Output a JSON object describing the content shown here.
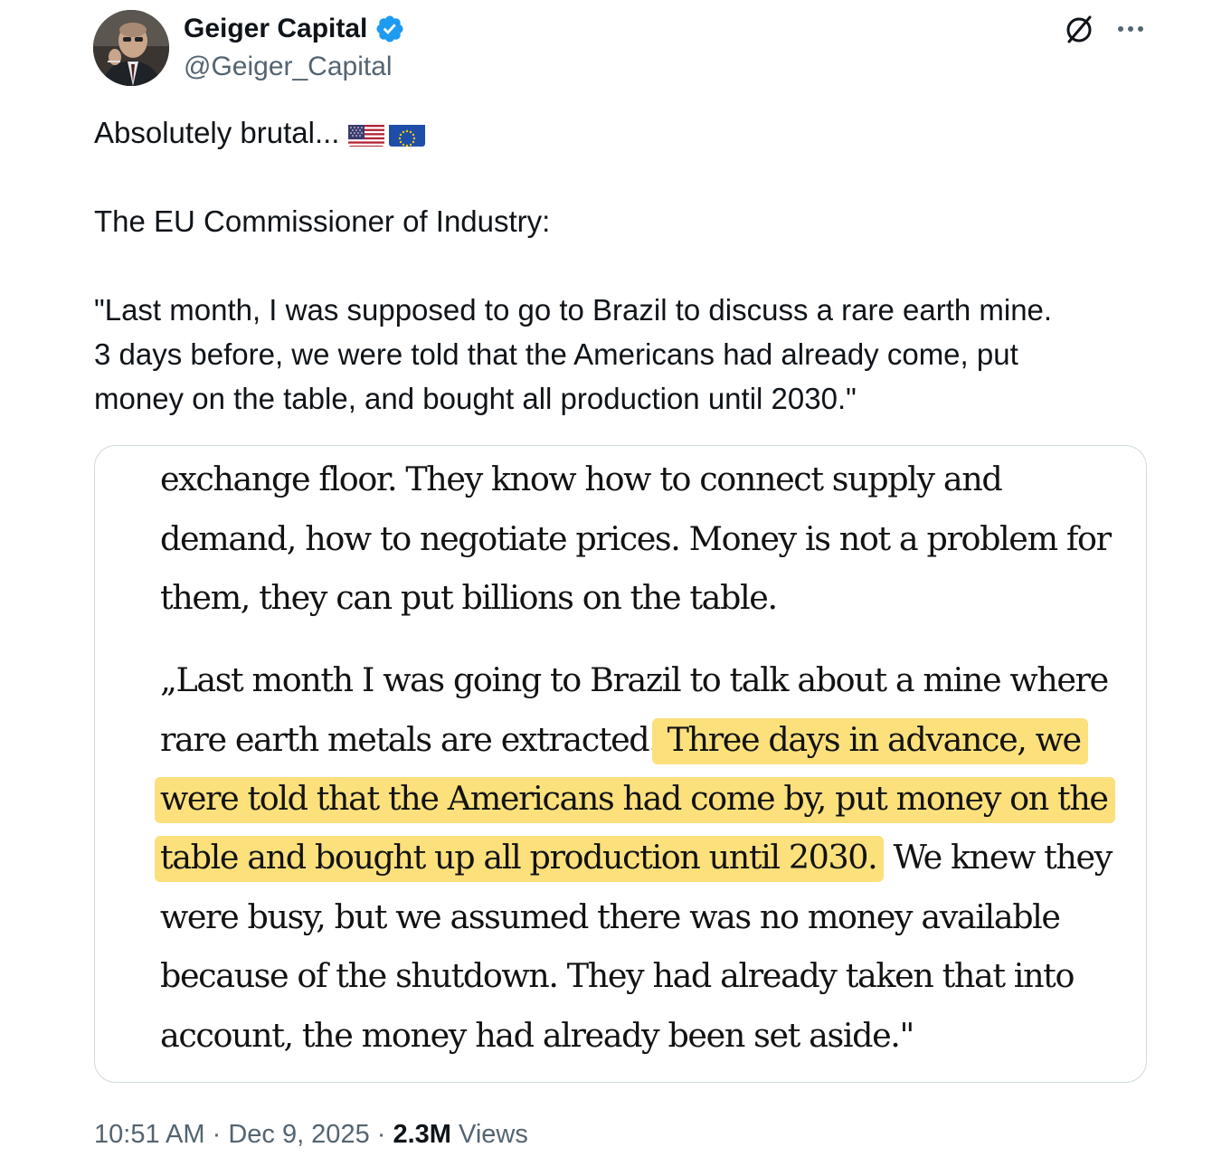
{
  "author": {
    "display_name": "Geiger Capital",
    "handle": "@Geiger_Capital",
    "verified": true,
    "avatar_icon": "person-portrait-avatar"
  },
  "header_actions": {
    "grok_icon": "grok-icon",
    "more_icon": "more-options-icon"
  },
  "tweet": {
    "line1": "Absolutely brutal...",
    "flags": [
      "us-flag",
      "eu-flag"
    ],
    "line2": "The EU Commissioner of Industry:",
    "quote_lines": [
      "\"Last month, I was supposed to go to Brazil to discuss a rare earth mine.",
      "3 days before, we were told that the Americans had already come, put",
      "money on the table, and bought all production until 2030.\""
    ]
  },
  "article_excerpt": {
    "p1_lines": [
      "exchange floor. They know how to connect supply and",
      "demand, how to negotiate prices. Money is not a problem for",
      "them, they can put billions on the table."
    ],
    "p2_line1": "„Last month I was going to Brazil to talk about a mine where",
    "p2_line2_plain": "rare earth metals are extracted.",
    "p2_line2_highlight": " Three days in advance, we",
    "p2_line3_highlight": "were told that the Americans had come by, put money on the",
    "p2_line4_highlight": "table and bought up all production until 2030.",
    "p2_line4_plain": " We knew they",
    "p2_rest": [
      "were busy, but we assumed there was no money available",
      "because of the shutdown. They had already taken that into",
      "account, the money had already been set aside.\""
    ],
    "highlight_color": "#fbe07c"
  },
  "meta": {
    "time": "10:51 AM",
    "separator": " · ",
    "date": "Dec 9, 2025",
    "views_count": "2.3M",
    "views_label": " Views"
  },
  "colors": {
    "text_primary": "#0f1419",
    "text_secondary": "#536471",
    "verified_blue": "#1d9bf0",
    "card_border": "#cfd9de"
  }
}
